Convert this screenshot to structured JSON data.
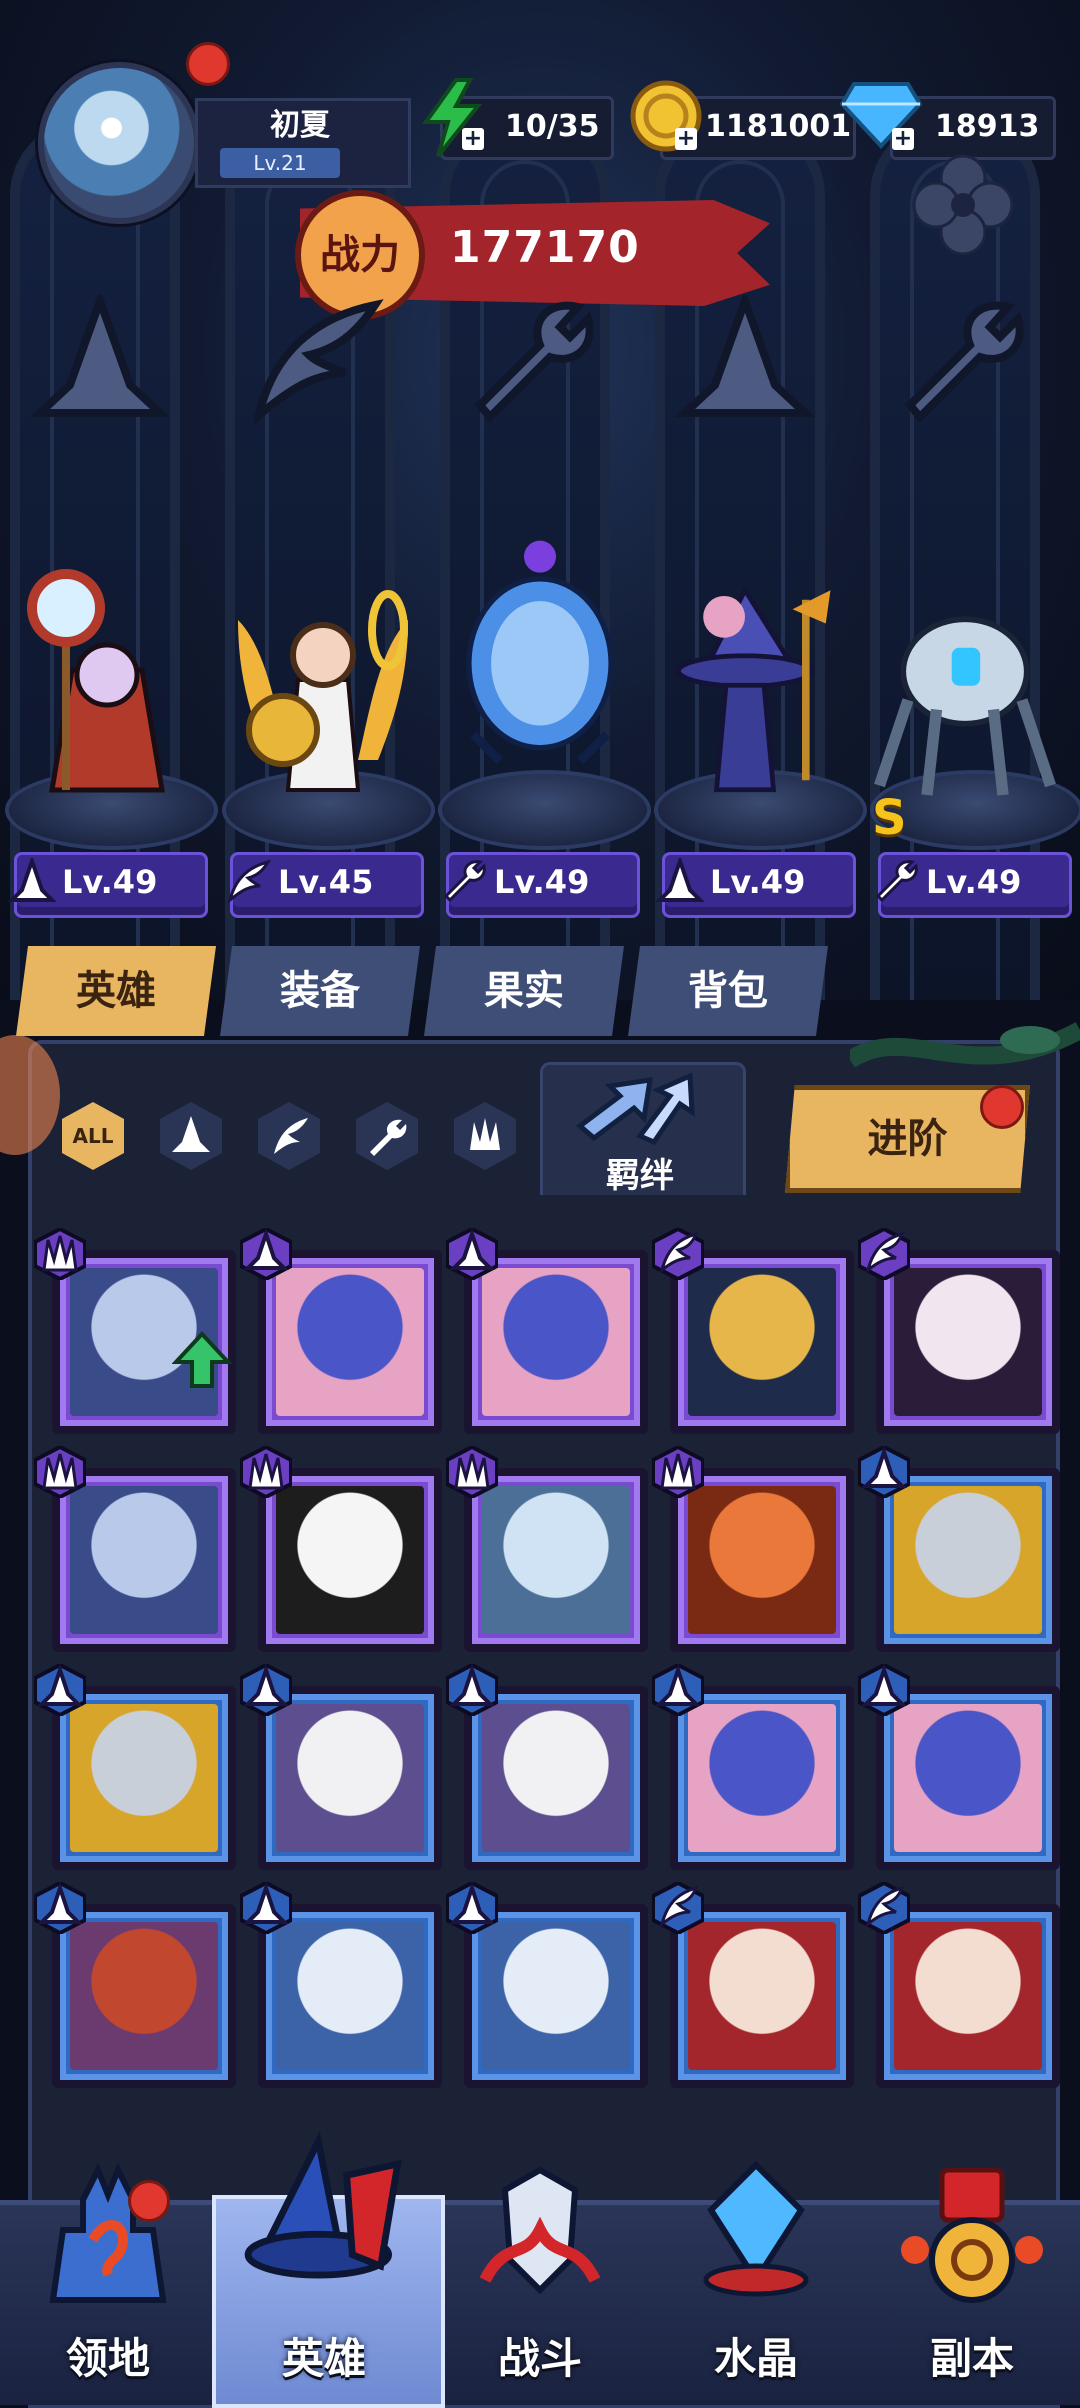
{
  "player": {
    "name": "初夏",
    "level": "Lv.21",
    "avatar": "player-avatar"
  },
  "resources": {
    "stamina": {
      "icon": "lightning-icon",
      "value": "10/35",
      "color": "#2bbd4a"
    },
    "gold": {
      "icon": "gold-coin-icon",
      "value": "1181001",
      "color": "#f1c232"
    },
    "diamond": {
      "icon": "diamond-icon",
      "value": "18913",
      "color": "#48b6ff"
    }
  },
  "power": {
    "badge": "战力",
    "value": "177170"
  },
  "lineup": [
    {
      "name": "eye-staff-mage",
      "class_icon": "mage-hat-icon",
      "level": "Lv.49"
    },
    {
      "name": "winged-goddess",
      "class_icon": "wing-icon",
      "level": "Lv.45"
    },
    {
      "name": "brain-jar-mech",
      "class_icon": "wrench-icon",
      "level": "Lv.49"
    },
    {
      "name": "brain-wizard",
      "class_icon": "mage-hat-icon",
      "level": "Lv.49"
    },
    {
      "name": "robot-walker",
      "class_icon": "wrench-icon",
      "level": "Lv.49",
      "rank": "S"
    }
  ],
  "tabs": [
    {
      "label": "英雄",
      "active": true
    },
    {
      "label": "装备",
      "active": false
    },
    {
      "label": "果实",
      "active": false
    },
    {
      "label": "背包",
      "active": false
    }
  ],
  "filters": {
    "all_label": "ALL",
    "items": [
      "mage-hat-icon",
      "wing-icon",
      "wrench-icon",
      "claw-icon"
    ]
  },
  "bond_label": "羁绊",
  "advance_label": "进阶",
  "hero_grid": [
    {
      "rarity": "purple",
      "class_icon": "claw-icon",
      "hero": "ice-dragon",
      "upgrade": true
    },
    {
      "rarity": "purple",
      "class_icon": "mage-hat-icon",
      "hero": "brain-wizard"
    },
    {
      "rarity": "purple",
      "class_icon": "mage-hat-icon",
      "hero": "brain-wizard"
    },
    {
      "rarity": "purple",
      "class_icon": "wing-icon",
      "hero": "pharaoh-queen"
    },
    {
      "rarity": "purple",
      "class_icon": "wing-icon",
      "hero": "dark-maiden"
    },
    {
      "rarity": "purple",
      "class_icon": "claw-icon",
      "hero": "ice-dragon"
    },
    {
      "rarity": "purple",
      "class_icon": "claw-icon",
      "hero": "panda-fighter"
    },
    {
      "rarity": "purple",
      "class_icon": "claw-icon",
      "hero": "polar-bear"
    },
    {
      "rarity": "purple",
      "class_icon": "claw-icon",
      "hero": "fire-fox"
    },
    {
      "rarity": "blue",
      "class_icon": "mage-hat-icon",
      "hero": "knight-helmet"
    },
    {
      "rarity": "blue",
      "class_icon": "mage-hat-icon",
      "hero": "knight-helmet"
    },
    {
      "rarity": "blue",
      "class_icon": "mage-hat-icon",
      "hero": "bandaged-nun"
    },
    {
      "rarity": "blue",
      "class_icon": "mage-hat-icon",
      "hero": "bandaged-nun"
    },
    {
      "rarity": "blue",
      "class_icon": "mage-hat-icon",
      "hero": "brain-wizard"
    },
    {
      "rarity": "blue",
      "class_icon": "mage-hat-icon",
      "hero": "brain-wizard"
    },
    {
      "rarity": "blue",
      "class_icon": "mage-hat-icon",
      "hero": "eye-staff-mage"
    },
    {
      "rarity": "blue",
      "class_icon": "mage-hat-icon",
      "hero": "ice-priestess"
    },
    {
      "rarity": "blue",
      "class_icon": "mage-hat-icon",
      "hero": "ice-priestess"
    },
    {
      "rarity": "blue",
      "class_icon": "wing-icon",
      "hero": "pale-lady"
    },
    {
      "rarity": "blue",
      "class_icon": "wing-icon",
      "hero": "pale-lady"
    }
  ],
  "nav": [
    {
      "label": "领地",
      "icon": "castle-icon",
      "badge": true
    },
    {
      "label": "英雄",
      "icon": "wizard-hat-icon",
      "active": true
    },
    {
      "label": "战斗",
      "icon": "sword-shield-icon"
    },
    {
      "label": "水晶",
      "icon": "crystal-icon"
    },
    {
      "label": "副本",
      "icon": "fortune-lantern-icon"
    }
  ]
}
